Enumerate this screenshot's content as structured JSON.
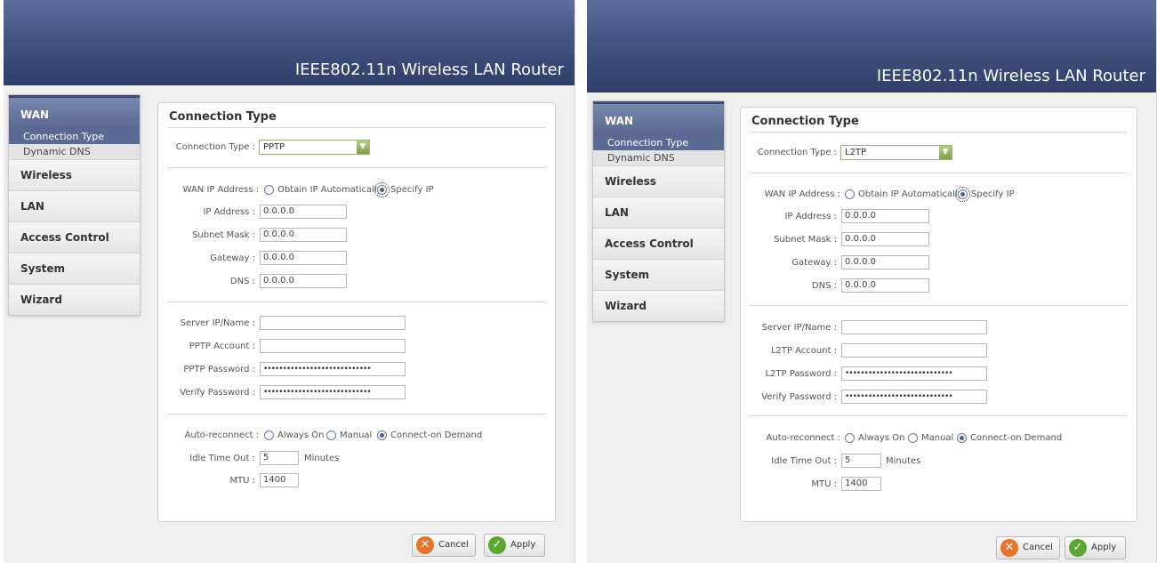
{
  "header": {
    "title": "IEEE802.11n  Wireless LAN Router"
  },
  "sidebar": {
    "section": "WAN",
    "subitems": [
      "Connection Type",
      "Dynamic DNS"
    ],
    "items": [
      "Wireless",
      "LAN",
      "Access Control",
      "System",
      "Wizard"
    ]
  },
  "left": {
    "heading": "Connection Type",
    "conn_type_label": "Connection Type :",
    "conn_type_value": "PPTP",
    "wan_ip_label": "WAN IP Address :",
    "obtain_label": "Obtain IP Automatically",
    "specify_label": "Specify IP",
    "ip_label": "IP Address :",
    "ip_value": "0.0.0.0",
    "subnet_label": "Subnet Mask :",
    "subnet_value": "0.0.0.0",
    "gateway_label": "Gateway :",
    "gateway_value": "0.0.0.0",
    "dns_label": "DNS :",
    "dns_value": "0.0.0.0",
    "server_label": "Server IP/Name :",
    "server_value": "",
    "account_label": "PPTP Account :",
    "account_value": "",
    "password_label": "PPTP Password :",
    "password_value": "••••••••••••••••••••••••••••",
    "verify_label": "Verify Password :",
    "verify_value": "••••••••••••••••••••••••••••",
    "auto_label": "Auto-reconnect :",
    "always_on": "Always On",
    "manual": "Manual",
    "on_demand": "Connect-on Demand",
    "idle_label": "Idle Time Out :",
    "idle_value": "5",
    "minutes": "Minutes",
    "mtu_label": "MTU :",
    "mtu_value": "1400",
    "cancel": "Cancel",
    "apply": "Apply"
  },
  "right": {
    "heading": "Connection Type",
    "conn_type_label": "Connection Type :",
    "conn_type_value": "L2TP",
    "wan_ip_label": "WAN IP Address :",
    "obtain_label": "Obtain IP Automatically",
    "specify_label": "Specify IP",
    "ip_label": "IP Address :",
    "ip_value": "0.0.0.0",
    "subnet_label": "Subnet Mask :",
    "subnet_value": "0.0.0.0",
    "gateway_label": "Gateway :",
    "gateway_value": "0.0.0.0",
    "dns_label": "DNS :",
    "dns_value": "0.0.0.0",
    "server_label": "Server IP/Name :",
    "server_value": "",
    "account_label": "L2TP Account :",
    "account_value": "",
    "password_label": "L2TP Password :",
    "password_value": "••••••••••••••••••••••••••••",
    "verify_label": "Verify Password :",
    "verify_value": "••••••••••••••••••••••••••••",
    "auto_label": "Auto-reconnect :",
    "always_on": "Always On",
    "manual": "Manual",
    "on_demand": "Connect-on Demand",
    "idle_label": "Idle Time Out :",
    "idle_value": "5",
    "minutes": "Minutes",
    "mtu_label": "MTU :",
    "mtu_value": "1400",
    "cancel": "Cancel",
    "apply": "Apply"
  },
  "colors": {
    "header": "#41527f",
    "accent": "#5b6a95",
    "apply_icon": "#5aa832",
    "cancel_icon": "#e8732a"
  }
}
